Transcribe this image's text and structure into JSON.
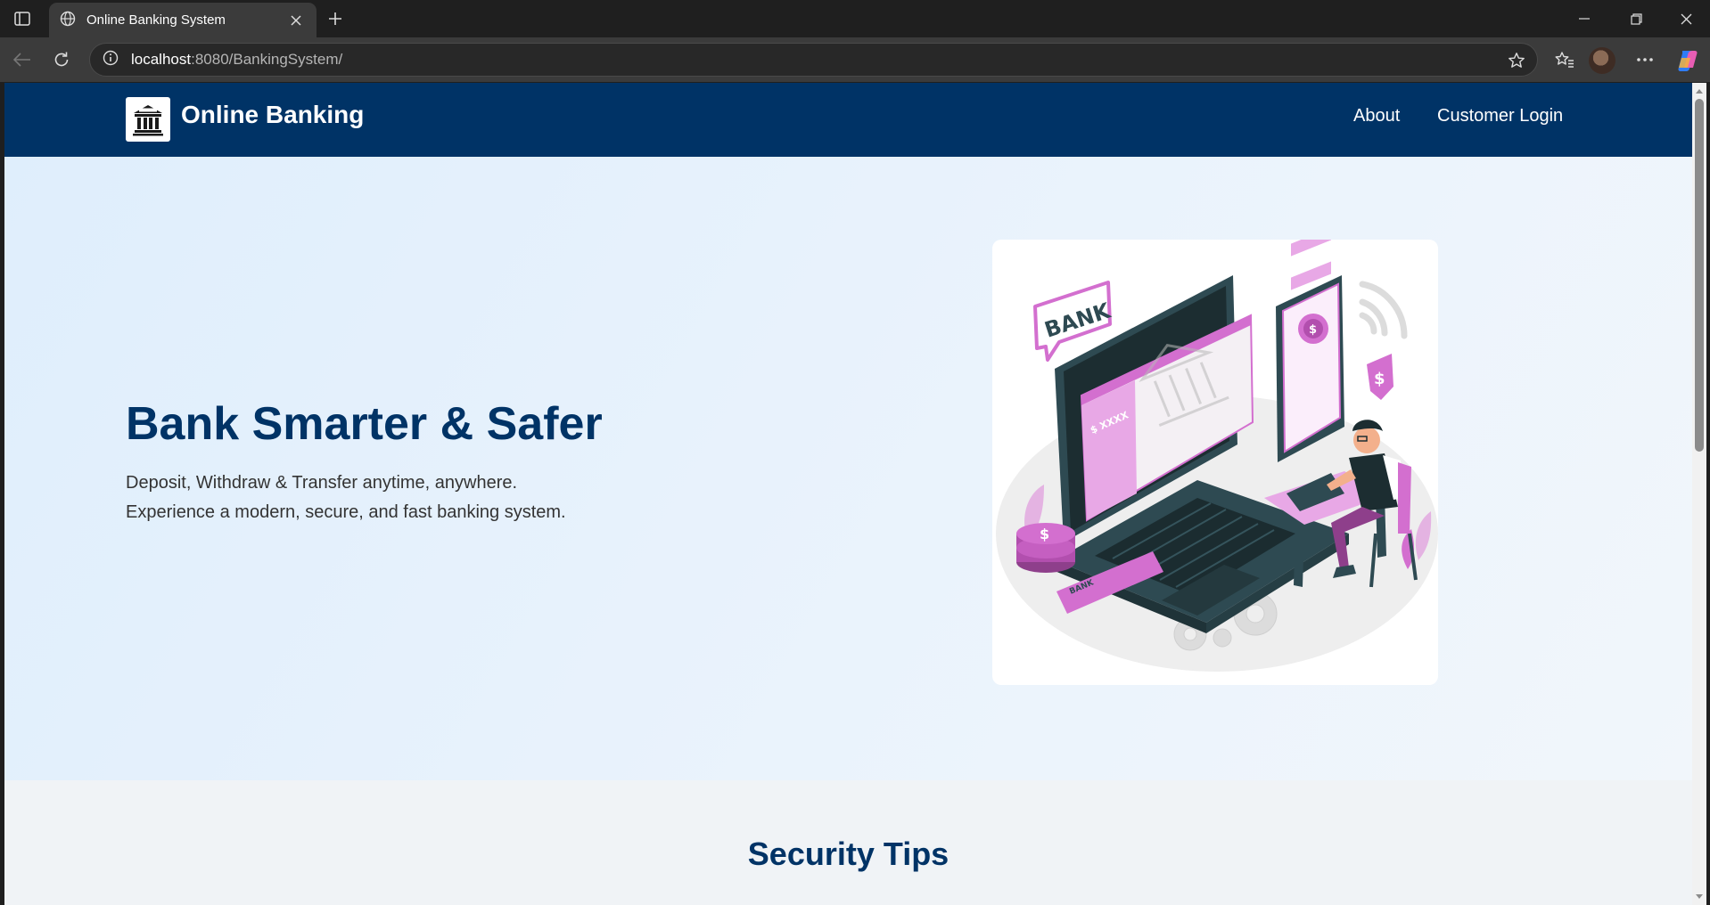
{
  "browser": {
    "tab_title": "Online Banking System",
    "url_host": "localhost",
    "url_rest": ":8080/BankingSystem/"
  },
  "nav": {
    "brand": "Online Banking",
    "links": [
      "About",
      "Customer Login"
    ]
  },
  "hero": {
    "title": "Bank Smarter & Safer",
    "subtitle_line1": "Deposit, Withdraw & Transfer anytime, anywhere.",
    "subtitle_line2": "Experience a modern, secure, and fast banking system."
  },
  "illustration": {
    "bank_bubble": "BANK",
    "screen_amount": "$ XXXX",
    "card_label": "BANK"
  },
  "security": {
    "title": "Security Tips"
  },
  "colors": {
    "navy": "#003366",
    "accent_pink": "#d36fcf",
    "hero_bg": "#e4f0fc"
  }
}
